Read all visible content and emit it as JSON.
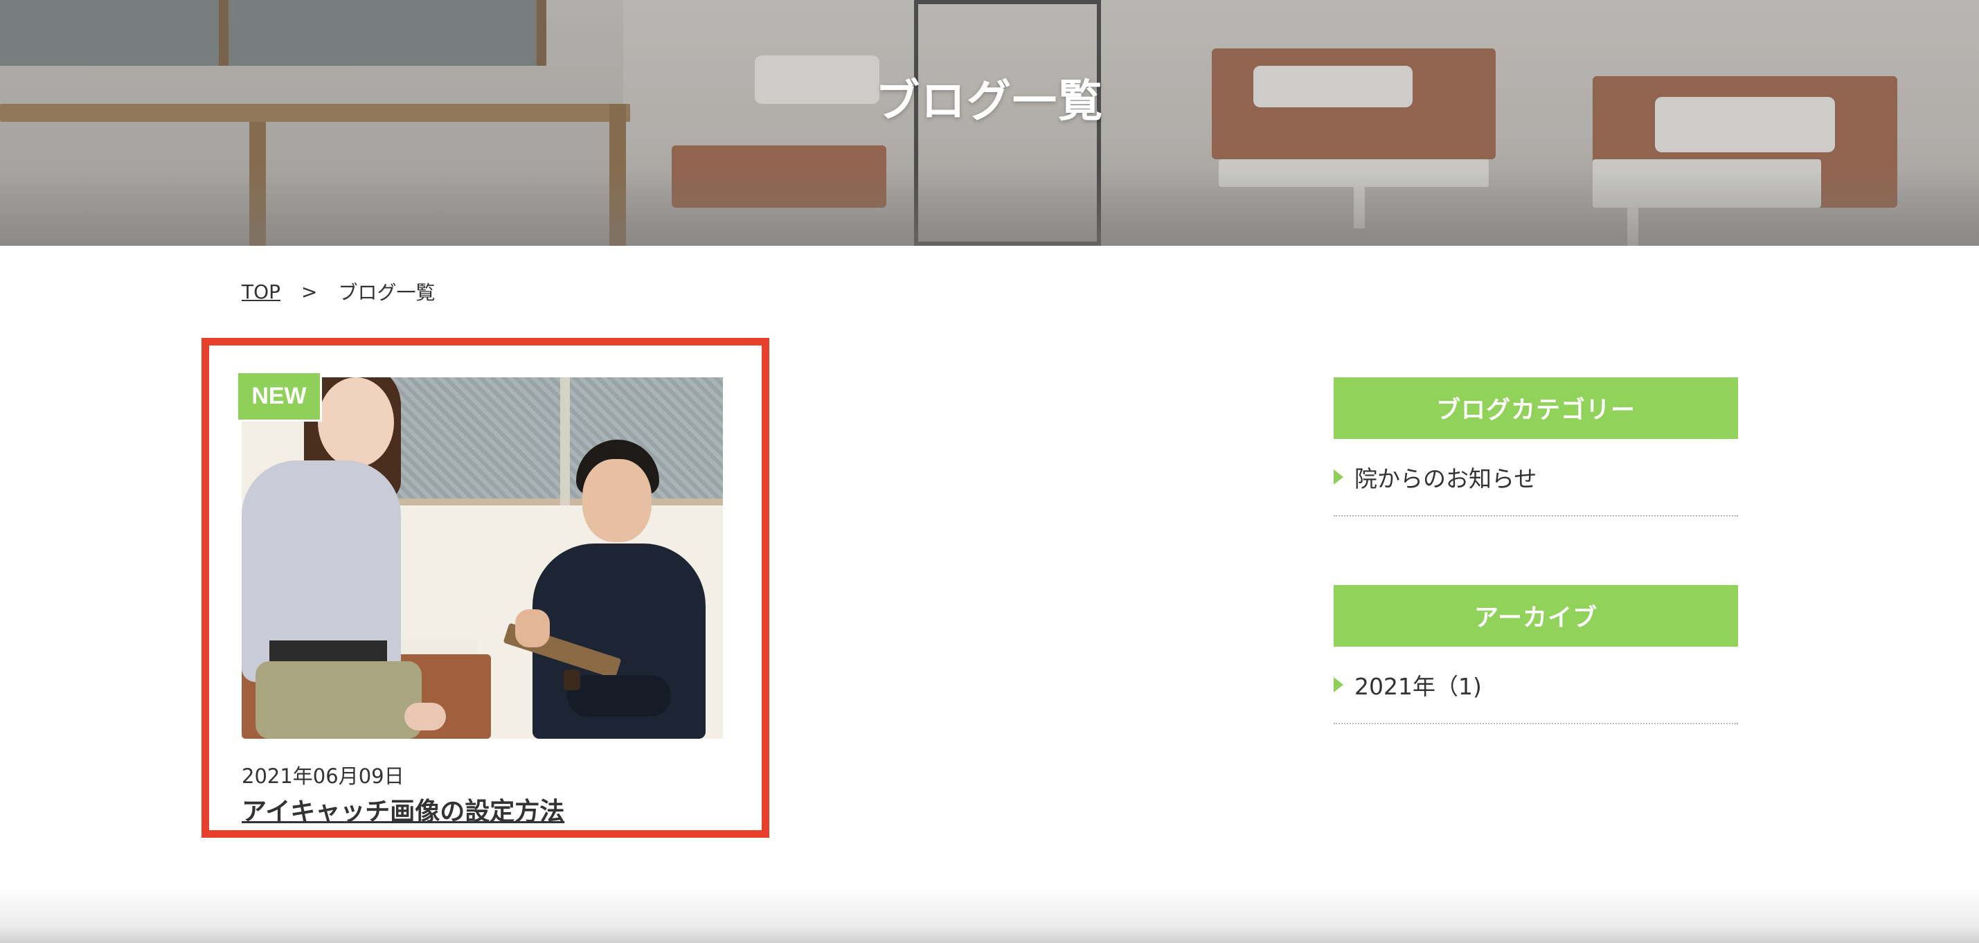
{
  "hero": {
    "title": "ブログ一覧"
  },
  "breadcrumb": {
    "home": "TOP",
    "separator": ">",
    "current": "ブログ一覧"
  },
  "post": {
    "badge": "NEW",
    "date": "2021年06月09日",
    "title": "アイキャッチ画像の設定方法",
    "image": "clinic-consultation-photo"
  },
  "sidebar": {
    "categories": {
      "heading": "ブログカテゴリー",
      "items": [
        {
          "label": "院からのお知らせ"
        }
      ]
    },
    "archive": {
      "heading": "アーカイブ",
      "items": [
        {
          "label": "2021年（1)"
        }
      ]
    }
  },
  "colors": {
    "accent_green": "#91d35a",
    "highlight_red": "#e8412b",
    "text": "#333333"
  },
  "icons": {
    "list_bullet": "triangle-right-icon"
  }
}
